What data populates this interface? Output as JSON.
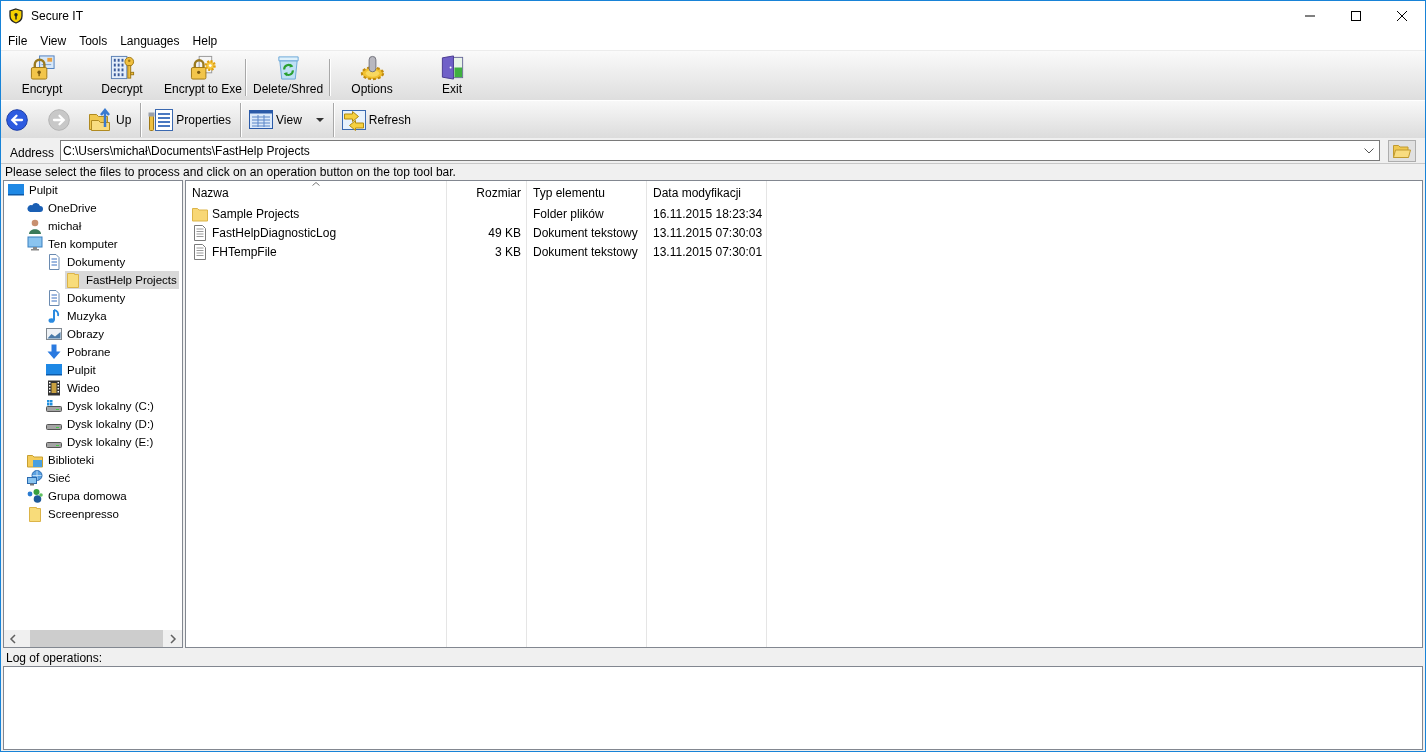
{
  "window": {
    "title": "Secure IT"
  },
  "menu": [
    "File",
    "View",
    "Tools",
    "Languages",
    "Help"
  ],
  "toolbar": {
    "groups": [
      {
        "buttons": [
          {
            "label": "Encrypt"
          },
          {
            "label": "Decrypt"
          },
          {
            "label": "Encrypt to Exe"
          }
        ]
      },
      {
        "buttons": [
          {
            "label": "Delete/Shred"
          }
        ]
      },
      {
        "buttons": [
          {
            "label": "Options"
          },
          {
            "label": "Exit"
          }
        ]
      }
    ]
  },
  "nav_toolbar": {
    "groups": [
      {
        "buttons": [
          {
            "disabled": false,
            "dropdown": false
          },
          {
            "disabled": true,
            "dropdown": false
          },
          {
            "label": "Up",
            "disabled": false,
            "dropdown": false
          }
        ]
      },
      {
        "buttons": [
          {
            "label": "Properties",
            "disabled": false,
            "dropdown": false
          }
        ]
      },
      {
        "buttons": [
          {
            "label": "View",
            "disabled": false,
            "dropdown": true
          }
        ]
      },
      {
        "buttons": [
          {
            "label": "Refresh",
            "disabled": false,
            "dropdown": false
          }
        ]
      }
    ]
  },
  "address": {
    "label": "Address",
    "value": "C:\\Users\\michał\\Documents\\FastHelp Projects"
  },
  "hint": "Please select the files to process and click on an operation button on the top tool bar.",
  "tree": {
    "items": [
      {
        "label": "Pulpit",
        "kind": "desktop",
        "selected": false,
        "children": [
          {
            "label": "OneDrive",
            "kind": "cloud",
            "selected": false
          },
          {
            "label": "michał",
            "kind": "user",
            "selected": false
          },
          {
            "label": "Ten komputer",
            "kind": "computer",
            "selected": false,
            "children": [
              {
                "label": "Dokumenty",
                "kind": "documents",
                "selected": false,
                "children": [
                  {
                    "label": "FastHelp Projects",
                    "kind": "folder",
                    "selected": true
                  }
                ]
              },
              {
                "label": "Dokumenty",
                "kind": "documents",
                "selected": false
              },
              {
                "label": "Muzyka",
                "kind": "music",
                "selected": false
              },
              {
                "label": "Obrazy",
                "kind": "pictures",
                "selected": false
              },
              {
                "label": "Pobrane",
                "kind": "downloads",
                "selected": false
              },
              {
                "label": "Pulpit",
                "kind": "desktop",
                "selected": false
              },
              {
                "label": "Wideo",
                "kind": "video",
                "selected": false
              },
              {
                "label": "Dysk lokalny (C:)",
                "kind": "system-drive",
                "selected": false
              },
              {
                "label": "Dysk lokalny (D:)",
                "kind": "drive",
                "selected": false
              },
              {
                "label": "Dysk lokalny (E:)",
                "kind": "drive",
                "selected": false
              }
            ]
          },
          {
            "label": "Biblioteki",
            "kind": "libraries",
            "selected": false
          },
          {
            "label": "Sieć",
            "kind": "network",
            "selected": false
          },
          {
            "label": "Grupa domowa",
            "kind": "homegroup",
            "selected": false
          },
          {
            "label": "Screenpresso",
            "kind": "folder",
            "selected": false
          }
        ]
      }
    ]
  },
  "file_list": {
    "columns": [
      {
        "label": "Nazwa",
        "sorted": true
      },
      {
        "label": "Rozmiar",
        "sorted": false
      },
      {
        "label": "Typ elementu",
        "sorted": false
      },
      {
        "label": "Data modyfikacji",
        "sorted": false
      }
    ],
    "rows": [
      {
        "kind": "folder",
        "name": "Sample Projects",
        "type": "Folder plików",
        "modified": "16.11.2015 18:23:34"
      },
      {
        "kind": "file",
        "name": "FastHelpDiagnosticLog",
        "size": "49 KB",
        "type": "Dokument tekstowy",
        "modified": "13.11.2015 07:30:03"
      },
      {
        "kind": "file",
        "name": "FHTempFile",
        "size": "3 KB",
        "type": "Dokument tekstowy",
        "modified": "13.11.2015 07:30:01"
      }
    ]
  },
  "log": {
    "label": "Log of operations:"
  }
}
